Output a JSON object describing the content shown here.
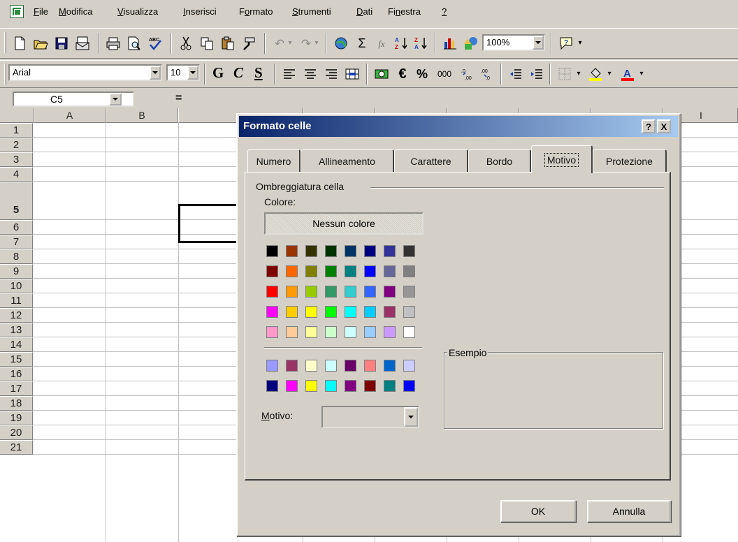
{
  "menu": {
    "items": [
      {
        "pre": "",
        "ul": "F",
        "post": "ile"
      },
      {
        "pre": "",
        "ul": "M",
        "post": "odifica"
      },
      {
        "pre": "",
        "ul": "V",
        "post": "isualizza"
      },
      {
        "pre": "",
        "ul": "I",
        "post": "nserisci"
      },
      {
        "pre": "F",
        "ul": "o",
        "post": "rmato"
      },
      {
        "pre": "",
        "ul": "S",
        "post": "trumenti"
      },
      {
        "pre": "",
        "ul": "D",
        "post": "ati"
      },
      {
        "pre": "Fi",
        "ul": "n",
        "post": "estra"
      },
      {
        "pre": "",
        "ul": "?",
        "post": ""
      }
    ]
  },
  "toolbar": {
    "zoom": "100%",
    "font_name": "Arial",
    "font_size": "10",
    "bold_label": "G",
    "italic_label": "C",
    "underline_label": "S",
    "currency_label": "€",
    "percent_label": "%",
    "thousands_label": "000",
    "sum_label": "Σ",
    "fx_label": "fx"
  },
  "formula_bar": {
    "cell_ref": "C5",
    "equals": "="
  },
  "grid": {
    "columns": [
      "A",
      "B",
      "",
      "",
      "",
      "",
      "",
      "",
      "I"
    ],
    "rows": [
      "1",
      "2",
      "3",
      "4",
      "5",
      "6",
      "7",
      "8",
      "9",
      "10",
      "11",
      "12",
      "13",
      "14",
      "15",
      "16",
      "17",
      "18",
      "19",
      "20",
      "21"
    ]
  },
  "dialog": {
    "title": "Formato celle",
    "help_btn": "?",
    "close_btn": "X",
    "tabs": [
      "Numero",
      "Allineamento",
      "Carattere",
      "Bordo",
      "Motivo",
      "Protezione"
    ],
    "active_tab": "Motivo",
    "shading_group": "Ombreggiatura cella",
    "color_label": "Colore:",
    "no_color": "Nessun colore",
    "example_label": "Esempio",
    "pattern_label_ul": "M",
    "pattern_label_rest": "otivo:",
    "ok": "OK",
    "cancel": "Annulla",
    "palette_main": [
      [
        "#000000",
        "#993300",
        "#333300",
        "#003300",
        "#003366",
        "#000080",
        "#333399",
        "#333333"
      ],
      [
        "#800000",
        "#ff6600",
        "#808000",
        "#008000",
        "#008080",
        "#0000ff",
        "#666699",
        "#808080"
      ],
      [
        "#ff0000",
        "#ff9900",
        "#99cc00",
        "#339966",
        "#33cccc",
        "#3366ff",
        "#800080",
        "#969696"
      ],
      [
        "#ff00ff",
        "#ffcc00",
        "#ffff00",
        "#00ff00",
        "#00ffff",
        "#00ccff",
        "#993366",
        "#c0c0c0"
      ],
      [
        "#ff99cc",
        "#ffcc99",
        "#ffff99",
        "#ccffcc",
        "#ccffff",
        "#99ccff",
        "#cc99ff",
        "#ffffff"
      ]
    ],
    "palette_chart": [
      [
        "#9999ff",
        "#993366",
        "#ffffcc",
        "#ccffff",
        "#660066",
        "#ff8080",
        "#0066cc",
        "#ccccff"
      ],
      [
        "#000080",
        "#ff00ff",
        "#ffff00",
        "#00ffff",
        "#800080",
        "#800000",
        "#008080",
        "#0000ff"
      ]
    ]
  }
}
